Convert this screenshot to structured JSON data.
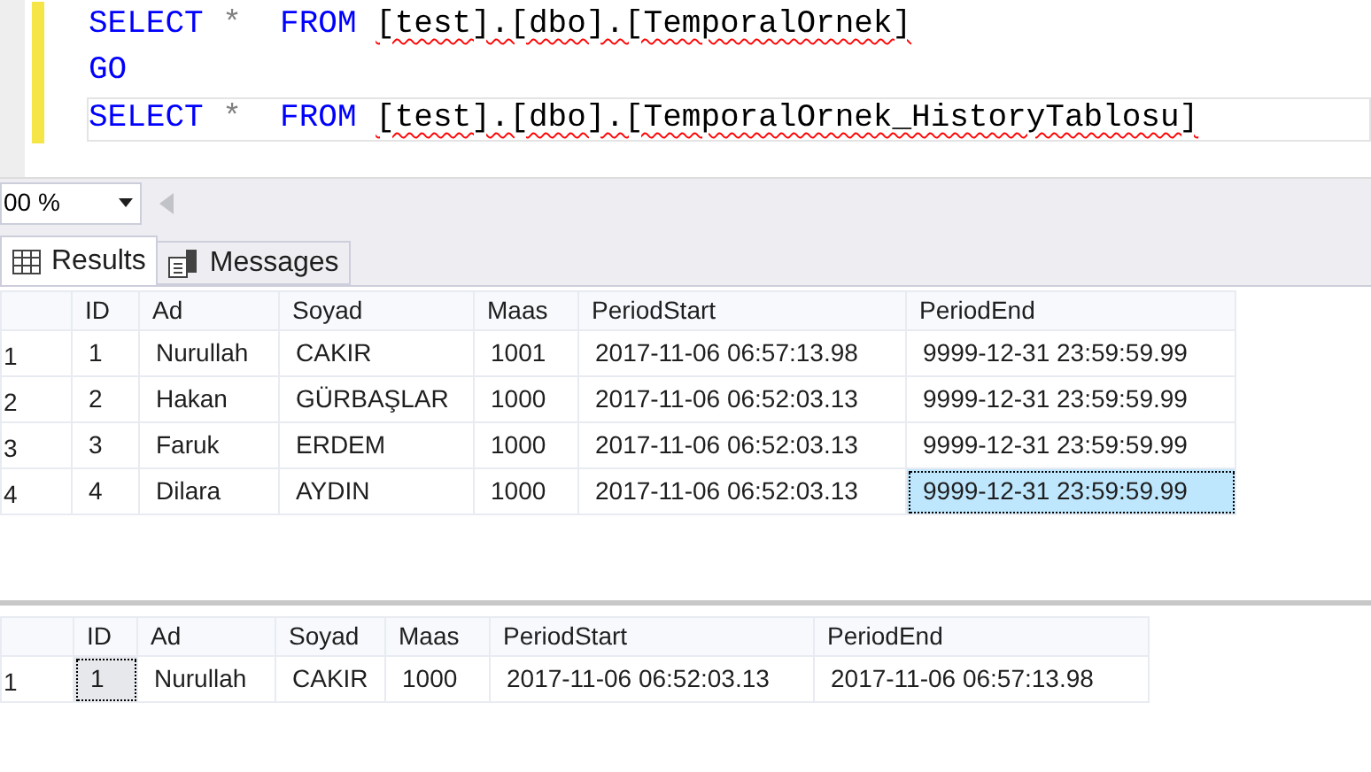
{
  "editor": {
    "lines": [
      {
        "current": false,
        "changed": true,
        "tokens": [
          {
            "kind": "keyword",
            "text": "SELECT"
          },
          {
            "kind": "operator",
            "text": "*"
          },
          {
            "kind": "keyword",
            "text": "FROM"
          },
          {
            "kind": "identifier",
            "text": "[test].[dbo].[TemporalOrnek]",
            "error": true
          }
        ]
      },
      {
        "current": false,
        "changed": true,
        "tokens": [
          {
            "kind": "keyword",
            "text": "GO"
          }
        ]
      },
      {
        "current": true,
        "changed": true,
        "tokens": [
          {
            "kind": "keyword",
            "text": "SELECT"
          },
          {
            "kind": "operator",
            "text": "*"
          },
          {
            "kind": "keyword",
            "text": "FROM"
          },
          {
            "kind": "identifier",
            "text": "[test].[dbo].[TemporalOrnek_HistoryTablosu]",
            "error": true
          }
        ]
      }
    ]
  },
  "zoom": {
    "value": "00 %"
  },
  "tabs": [
    {
      "label": "Results",
      "selected": true,
      "kind": "grid"
    },
    {
      "label": "Messages",
      "selected": false,
      "kind": "messages"
    }
  ],
  "grids": [
    {
      "active": true,
      "columns": [
        "ID",
        "Ad",
        "Soyad",
        "Maas",
        "PeriodStart",
        "PeriodEnd"
      ],
      "rows": [
        {
          "number": "1",
          "cells": [
            {
              "text": "1",
              "selected": false
            },
            {
              "text": "Nurullah",
              "selected": false
            },
            {
              "text": "CAKIR",
              "selected": false
            },
            {
              "text": "1001",
              "selected": false
            },
            {
              "text": "2017-11-06 06:57:13.98",
              "selected": false
            },
            {
              "text": "9999-12-31 23:59:59.99",
              "selected": false
            }
          ]
        },
        {
          "number": "2",
          "cells": [
            {
              "text": "2",
              "selected": false
            },
            {
              "text": "Hakan",
              "selected": false
            },
            {
              "text": "GÜRBAŞLAR",
              "selected": false
            },
            {
              "text": "1000",
              "selected": false
            },
            {
              "text": "2017-11-06 06:52:03.13",
              "selected": false
            },
            {
              "text": "9999-12-31 23:59:59.99",
              "selected": false
            }
          ]
        },
        {
          "number": "3",
          "cells": [
            {
              "text": "3",
              "selected": false
            },
            {
              "text": "Faruk",
              "selected": false
            },
            {
              "text": "ERDEM",
              "selected": false
            },
            {
              "text": "1000",
              "selected": false
            },
            {
              "text": "2017-11-06 06:52:03.13",
              "selected": false
            },
            {
              "text": "9999-12-31 23:59:59.99",
              "selected": false
            }
          ]
        },
        {
          "number": "4",
          "cells": [
            {
              "text": "4",
              "selected": false
            },
            {
              "text": "Dilara",
              "selected": false
            },
            {
              "text": "AYDIN",
              "selected": false
            },
            {
              "text": "1000",
              "selected": false
            },
            {
              "text": "2017-11-06 06:52:03.13",
              "selected": false
            },
            {
              "text": "9999-12-31 23:59:59.99",
              "selected": true
            }
          ]
        }
      ]
    },
    {
      "active": false,
      "columns": [
        "ID",
        "Ad",
        "Soyad",
        "Maas",
        "PeriodStart",
        "PeriodEnd"
      ],
      "rows": [
        {
          "number": "1",
          "cells": [
            {
              "text": "1",
              "selected": true
            },
            {
              "text": "Nurullah",
              "selected": false
            },
            {
              "text": "CAKIR",
              "selected": false
            },
            {
              "text": "1000",
              "selected": false
            },
            {
              "text": "2017-11-06 06:52:03.13",
              "selected": false
            },
            {
              "text": "2017-11-06 06:57:13.98",
              "selected": false
            }
          ]
        }
      ]
    }
  ]
}
